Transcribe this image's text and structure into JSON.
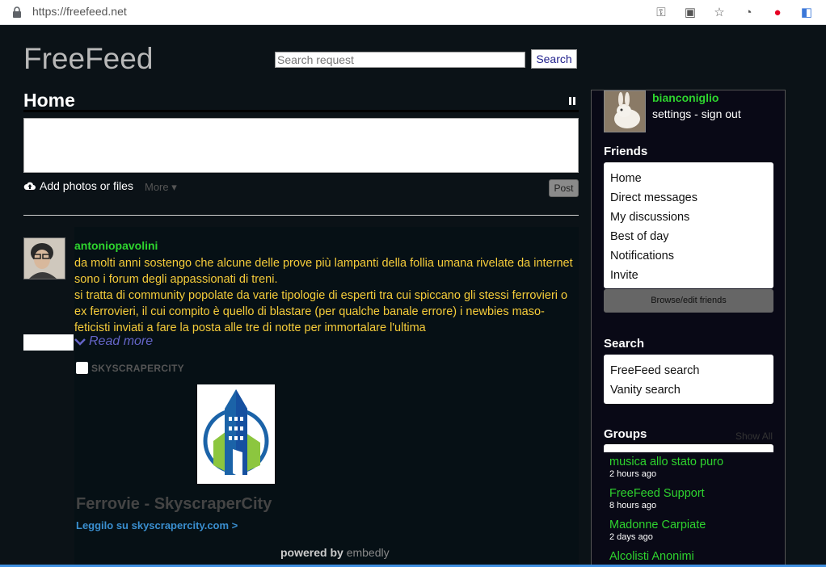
{
  "browser": {
    "url": "https://freefeed.net",
    "icons": [
      "lock-icon",
      "key-icon",
      "translate-icon",
      "star-icon",
      "speedometer-icon",
      "pinterest-icon",
      "extension-icon"
    ]
  },
  "header": {
    "logo": "FreeFeed",
    "search_placeholder": "Search request",
    "search_button": "Search"
  },
  "home": {
    "title": "Home",
    "add_photos": "Add photos or files",
    "more": "More ▾",
    "post_button": "Post"
  },
  "post": {
    "author": "antoniopavolini",
    "body_lines": [
      "da molti anni sostengo che alcune delle prove più lampanti della follia umana rivelate da internet sono i forum degli appassionati di treni.",
      "si tratta di community popolate da varie tipologie di esperti tra cui spiccano gli stessi ferrovieri o ex ferrovieri, il cui compito è quello di blastare (per qualche banale errore) i newbies maso-feticisti inviati a fare la posta alle tre di notte per immortalare l'ultima"
    ],
    "read_more": "Read more",
    "embed": {
      "site": "SKYSCRAPERCITY",
      "title": "Ferrovie - SkyscraperCity",
      "link": "Leggilo su skyscrapercity.com >",
      "powered_by": "powered by",
      "embedly": "embedly"
    }
  },
  "sidebar": {
    "username": "bianconiglio",
    "user_links": "settings - sign out",
    "friends_heading": "Friends",
    "friends_items": [
      "Home",
      "Direct messages",
      "My discussions",
      "Best of day",
      "Notifications",
      "Invite"
    ],
    "browse_button": "Browse/edit friends",
    "search_heading": "Search",
    "search_items": [
      "FreeFeed search",
      "Vanity search"
    ],
    "groups_heading": "Groups",
    "show_all": "Show All",
    "groups": [
      {
        "name": "musica allo stato puro",
        "time": "2 hours ago"
      },
      {
        "name": "FreeFeed Support",
        "time": "8 hours ago"
      },
      {
        "name": "Madonne Carpiate",
        "time": "2 days ago"
      },
      {
        "name": "Alcolisti Anonimi",
        "time": ""
      }
    ]
  }
}
